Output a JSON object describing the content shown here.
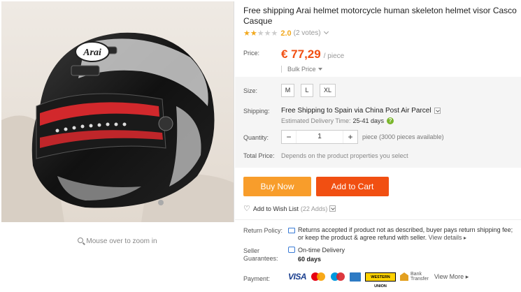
{
  "product": {
    "title": "Free shipping Arai helmet motorcycle human skeleton helmet visor Casco Casque",
    "rating": {
      "stars_filled": 2,
      "stars_total": 5,
      "score": "2.0",
      "votes": "(2 votes)"
    },
    "image_alt": "Arai helmet photo",
    "zoom_hint": "Mouse over to zoom in",
    "brand_logo_text": "Arai"
  },
  "price": {
    "label": "Price:",
    "amount": "€ 77,29",
    "unit": "/ piece",
    "bulk": "Bulk Price"
  },
  "size": {
    "label": "Size:",
    "options": [
      "M",
      "L",
      "XL"
    ]
  },
  "shipping": {
    "label": "Shipping:",
    "text": "Free Shipping to Spain via China Post Air Parcel",
    "delivery_label": "Estimated Delivery Time:",
    "delivery_days": "25-41 days"
  },
  "quantity": {
    "label": "Quantity:",
    "minus": "−",
    "value": "1",
    "plus": "+",
    "note": "piece (3000 pieces available)"
  },
  "total": {
    "label": "Total Price:",
    "note": "Depends on the product properties you select"
  },
  "actions": {
    "buy_now": "Buy Now",
    "add_to_cart": "Add to Cart",
    "wishlist": "Add to Wish List",
    "wishlist_count": "(22 Adds)"
  },
  "return_policy": {
    "label": "Return Policy:",
    "text": "Returns accepted if product not as described, buyer pays return shipping fee; or keep the product & agree refund with seller.",
    "link": "View details"
  },
  "guarantee": {
    "label_1": "Seller",
    "label_2": "Guarantees:",
    "name": "On-time Delivery",
    "days": "60 days"
  },
  "payment": {
    "label": "Payment:",
    "visa": "VISA",
    "western_union": "WESTERN UNION",
    "bank_1": "Bank",
    "bank_2": "Transfer",
    "view_more": "View More"
  },
  "colors": {
    "accent_price": "#f14f12",
    "buy_now": "#f89d2b",
    "add_to_cart": "#f14f12",
    "star": "#f2a91e"
  }
}
